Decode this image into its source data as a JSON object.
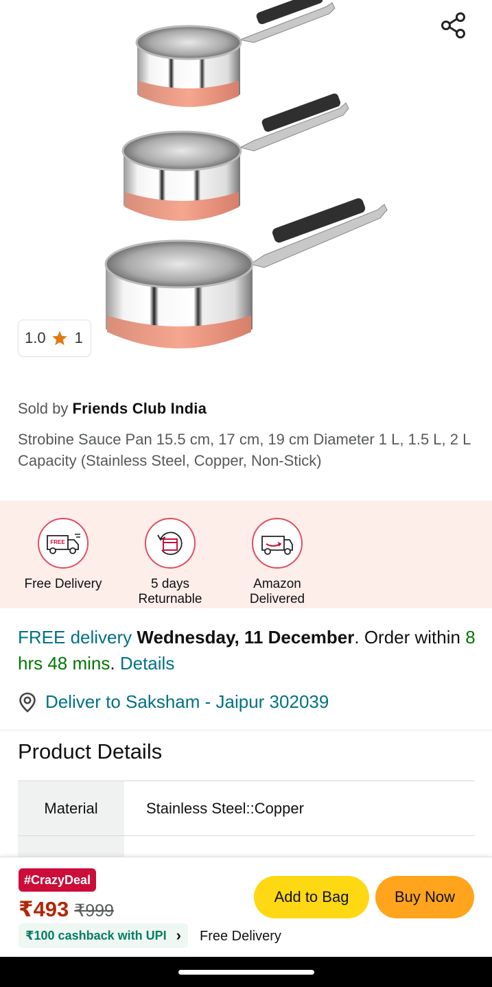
{
  "product": {
    "rating_value": "1.0",
    "rating_count": "1",
    "sold_by_prefix": "Sold by",
    "seller": "Friends Club India",
    "title": "Strobine Sauce Pan 15.5 cm, 17 cm, 19 cm Diameter 1 L, 1.5 L, 2 L Capacity (Stainless Steel, Copper, Non-Stick)",
    "image_icon": "saucepan-set-image",
    "share_icon": "share-icon"
  },
  "features": [
    {
      "label": "Free Delivery",
      "icon": "free-delivery-truck-icon",
      "badge": "FREE"
    },
    {
      "label": "5 days Returnable",
      "icon": "return-box-icon"
    },
    {
      "label": "Amazon Delivered",
      "icon": "amazon-van-icon"
    }
  ],
  "delivery": {
    "free_text": "FREE delivery",
    "date": "Wednesday, 11 December",
    "order_within": ". Order within",
    "time": "8 hrs 48 mins",
    "details": "Details",
    "deliver_to": "Deliver to Saksham - Jaipur 302039"
  },
  "product_details": {
    "heading": "Product Details",
    "rows": [
      {
        "key": "Material",
        "value": "Stainless Steel::Copper"
      }
    ]
  },
  "buy_bar": {
    "deal_badge": "#CrazyDeal",
    "price": "₹493",
    "mrp": "₹999",
    "cashback": "₹100 cashback with UPI",
    "free_delivery": "Free Delivery",
    "add_to_bag": "Add to Bag",
    "buy_now": "Buy Now"
  },
  "colors": {
    "link": "#007185",
    "green": "#007600",
    "price": "#b12704",
    "deal": "#cc0c39",
    "add_to_bag": "#ffd814",
    "buy_now": "#ffa41c",
    "feature_bg": "#fdeeea",
    "star": "#e47911"
  }
}
